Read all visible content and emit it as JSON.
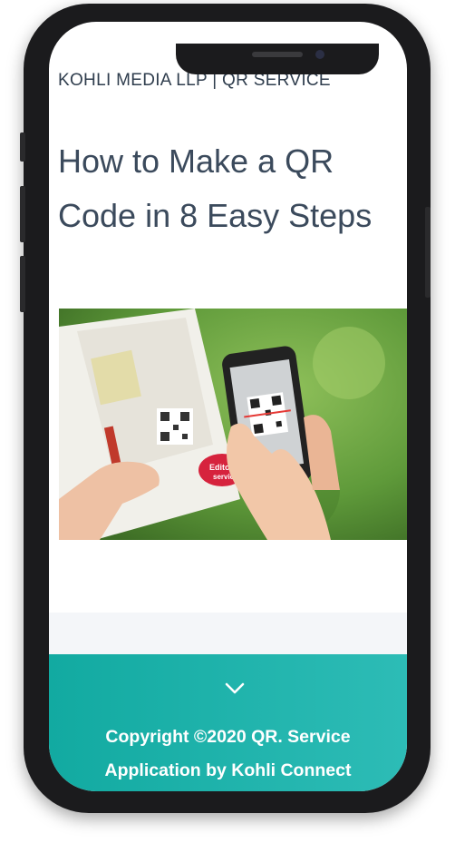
{
  "header": {
    "brand": "KOHLI MEDIA LLP | QR SERVICE"
  },
  "article": {
    "title": "How to Make a QR Code in 8 Easy Steps"
  },
  "hero_image": {
    "description_icon": "qr-scan-photo",
    "magazine_text": [
      "Editorial",
      "service"
    ]
  },
  "footer": {
    "expand_icon": "chevron-down-icon",
    "copyright": "Copyright ©2020 QR. Service",
    "credit": "Application by Kohli Connect"
  },
  "colors": {
    "title": "#3b4a5c",
    "brand": "#2f3d4d",
    "footer_start": "#12aaa1",
    "footer_end": "#2dbcb6"
  }
}
